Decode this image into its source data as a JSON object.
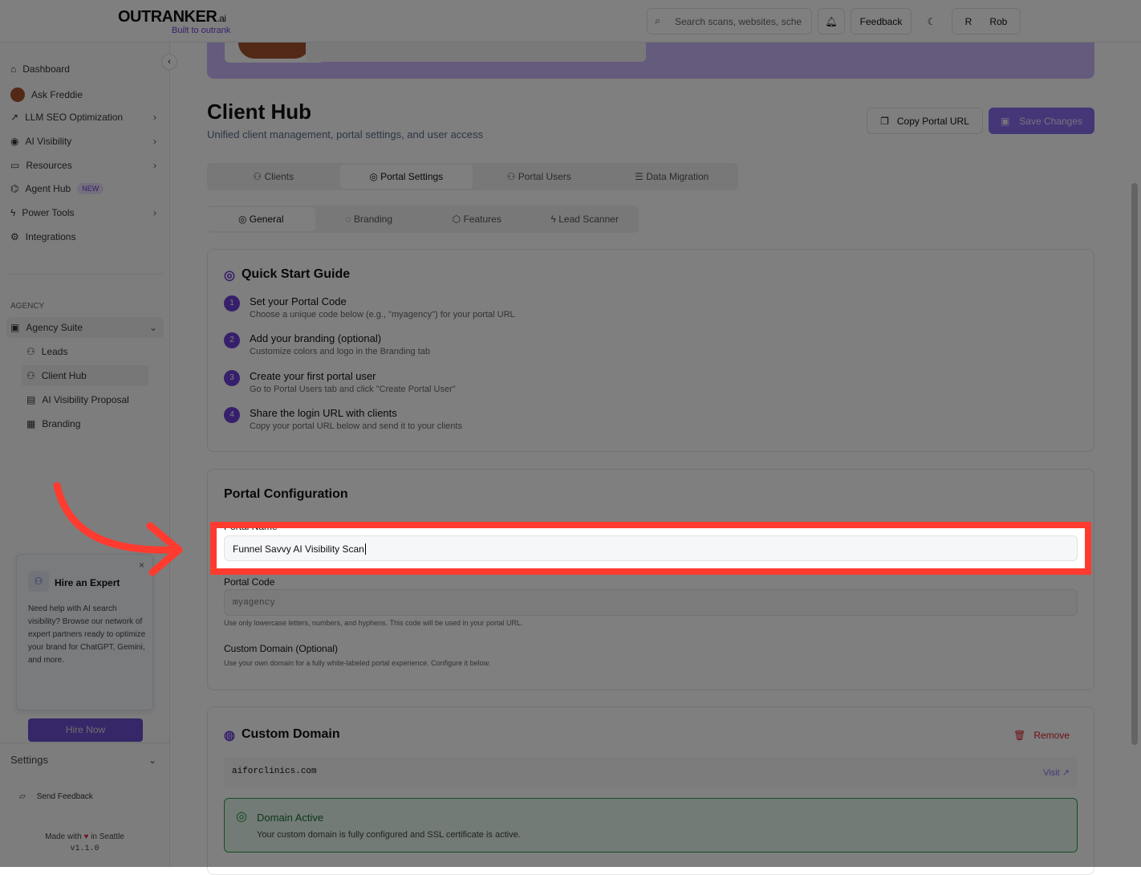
{
  "header": {
    "logo": "OUTRANKER",
    "logo_suffix": ".ai",
    "tagline": "Built to outrank",
    "search_placeholder": "Search scans, websites, sche",
    "feedback": "Feedback",
    "avatar_initial": "R",
    "user": "Rob"
  },
  "sidebar": {
    "items": [
      {
        "label": "Dashboard"
      },
      {
        "label": "Ask Freddie"
      },
      {
        "label": "LLM SEO Optimization"
      },
      {
        "label": "AI Visibility"
      },
      {
        "label": "Resources"
      },
      {
        "label": "Agent Hub",
        "badge": "NEW"
      },
      {
        "label": "Power Tools"
      },
      {
        "label": "Integrations"
      }
    ],
    "section": "AGENCY",
    "group": "Agency Suite",
    "sub": [
      {
        "label": "Leads"
      },
      {
        "label": "Client Hub"
      },
      {
        "label": "AI Visibility Proposal"
      },
      {
        "label": "Branding"
      }
    ],
    "promo": {
      "title": "Hire an Expert",
      "body": "Need help with AI search visibility? Browse our network of expert partners ready to optimize your brand for ChatGPT, Gemini, and more.",
      "button": "Hire Now"
    },
    "settings": "Settings",
    "send_feedback": "Send Feedback",
    "made_with": "Made with",
    "in_city": "in Seattle",
    "version": "v1.1.0"
  },
  "page": {
    "title": "Client Hub",
    "subtitle": "Unified client management, portal settings, and user access",
    "copy_url": "Copy Portal URL",
    "save": "Save Changes",
    "tabs": [
      "Clients",
      "Portal Settings",
      "Portal Users",
      "Data Migration"
    ],
    "subtabs": [
      "General",
      "Branding",
      "Features",
      "Lead Scanner"
    ]
  },
  "guide": {
    "title": "Quick Start Guide",
    "steps": [
      {
        "n": "1",
        "title": "Set your Portal Code",
        "desc": "Choose a unique code below (e.g., \"myagency\") for your portal URL"
      },
      {
        "n": "2",
        "title": "Add your branding (optional)",
        "desc": "Customize colors and logo in the Branding tab"
      },
      {
        "n": "3",
        "title": "Create your first portal user",
        "desc": "Go to Portal Users tab and click \"Create Portal User\""
      },
      {
        "n": "4",
        "title": "Share the login URL with clients",
        "desc": "Copy your portal URL below and send it to your clients"
      }
    ]
  },
  "config": {
    "title": "Portal Configuration",
    "name_label": "Portal Name",
    "name_value": "Funnel Savvy AI Visibility Scan",
    "code_label": "Portal Code",
    "code_placeholder": "myagency",
    "code_help": "Use only lowercase letters, numbers, and hyphens. This code will be used in your portal URL.",
    "domain_label": "Custom Domain (Optional)",
    "domain_help": "Use your own domain for a fully white-labeled portal experience. Configure it below."
  },
  "domain": {
    "title": "Custom Domain",
    "remove": "Remove",
    "value": "aiforclinics.com",
    "visit": "Visit",
    "status_title": "Domain Active",
    "status_desc": "Your custom domain is fully configured and SSL certificate is active."
  }
}
